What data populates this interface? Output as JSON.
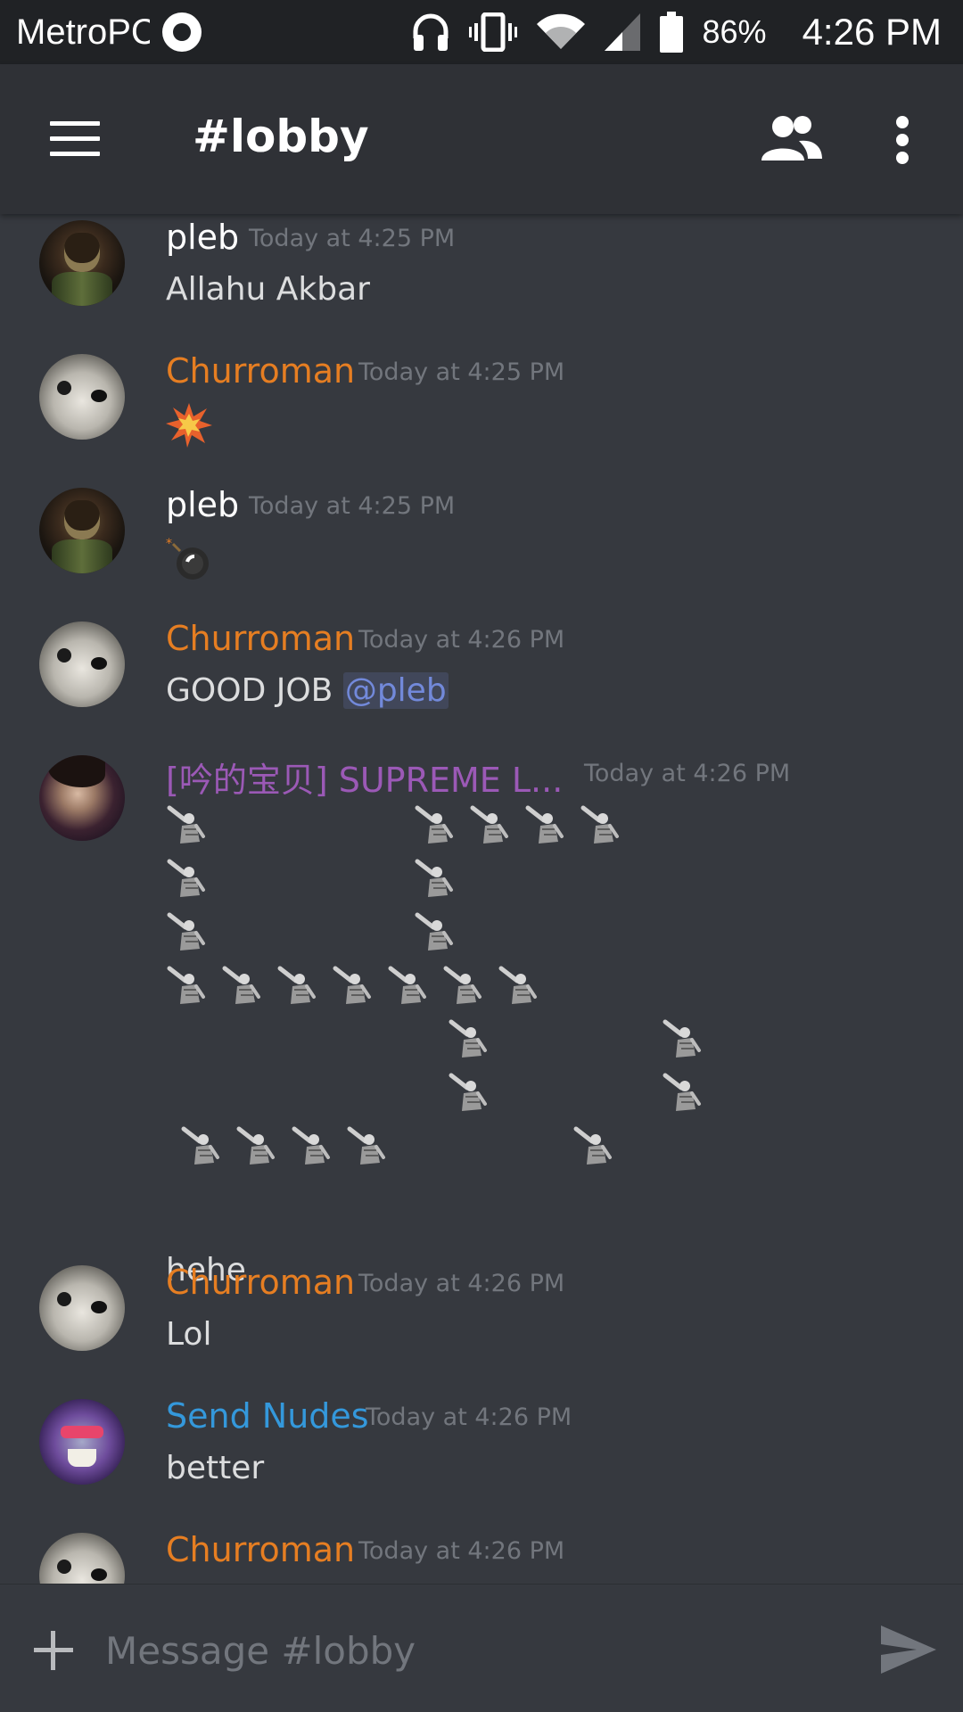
{
  "status_bar": {
    "carrier": "MetroPCS",
    "battery_percent": "86%",
    "time": "4:26 PM",
    "icons": [
      "music-icon",
      "headphones-icon",
      "vibrate-icon",
      "wifi-icon",
      "signal-icon",
      "battery-icon"
    ]
  },
  "toolbar": {
    "channel_title": "#lobby",
    "icons": [
      "menu-icon",
      "members-icon",
      "overflow-menu-icon"
    ]
  },
  "colors": {
    "background": "#36393f",
    "toolbar": "#2f3136",
    "status_bar": "#202225",
    "pleb": "#ffffff",
    "churroman": "#e67e22",
    "supreme": "#9b59b6",
    "send_nudes": "#3498db",
    "mention": "#7289da",
    "timestamp": "#72767d"
  },
  "messages": [
    {
      "author": "pleb",
      "timestamp": "Today at 4:25 PM",
      "text": "Allahu Akbar"
    },
    {
      "author": "Churroman",
      "timestamp": "Today at 4:25 PM",
      "emoji": "collision-icon"
    },
    {
      "author": "pleb",
      "timestamp": "Today at 4:25 PM",
      "emoji": "bomb-icon"
    },
    {
      "author": "Churroman",
      "timestamp": "Today at 4:26 PM",
      "text": "GOOD JOB ",
      "mention": "@pleb"
    },
    {
      "author": "[吟的宝贝] SUPREME L...",
      "timestamp": "Today at 4:26 PM",
      "emoji": "saluting-figure-icon",
      "text": "hehe"
    },
    {
      "author": "Churroman",
      "timestamp": "Today at 4:26 PM",
      "text": "Lol"
    },
    {
      "author": "Send Nudes",
      "timestamp": "Today at 4:26 PM",
      "text": "better"
    },
    {
      "author": "Churroman",
      "timestamp": "Today at 4:26 PM"
    }
  ],
  "composer": {
    "placeholder": "Message #lobby",
    "icons": [
      "add-icon",
      "send-icon"
    ]
  }
}
